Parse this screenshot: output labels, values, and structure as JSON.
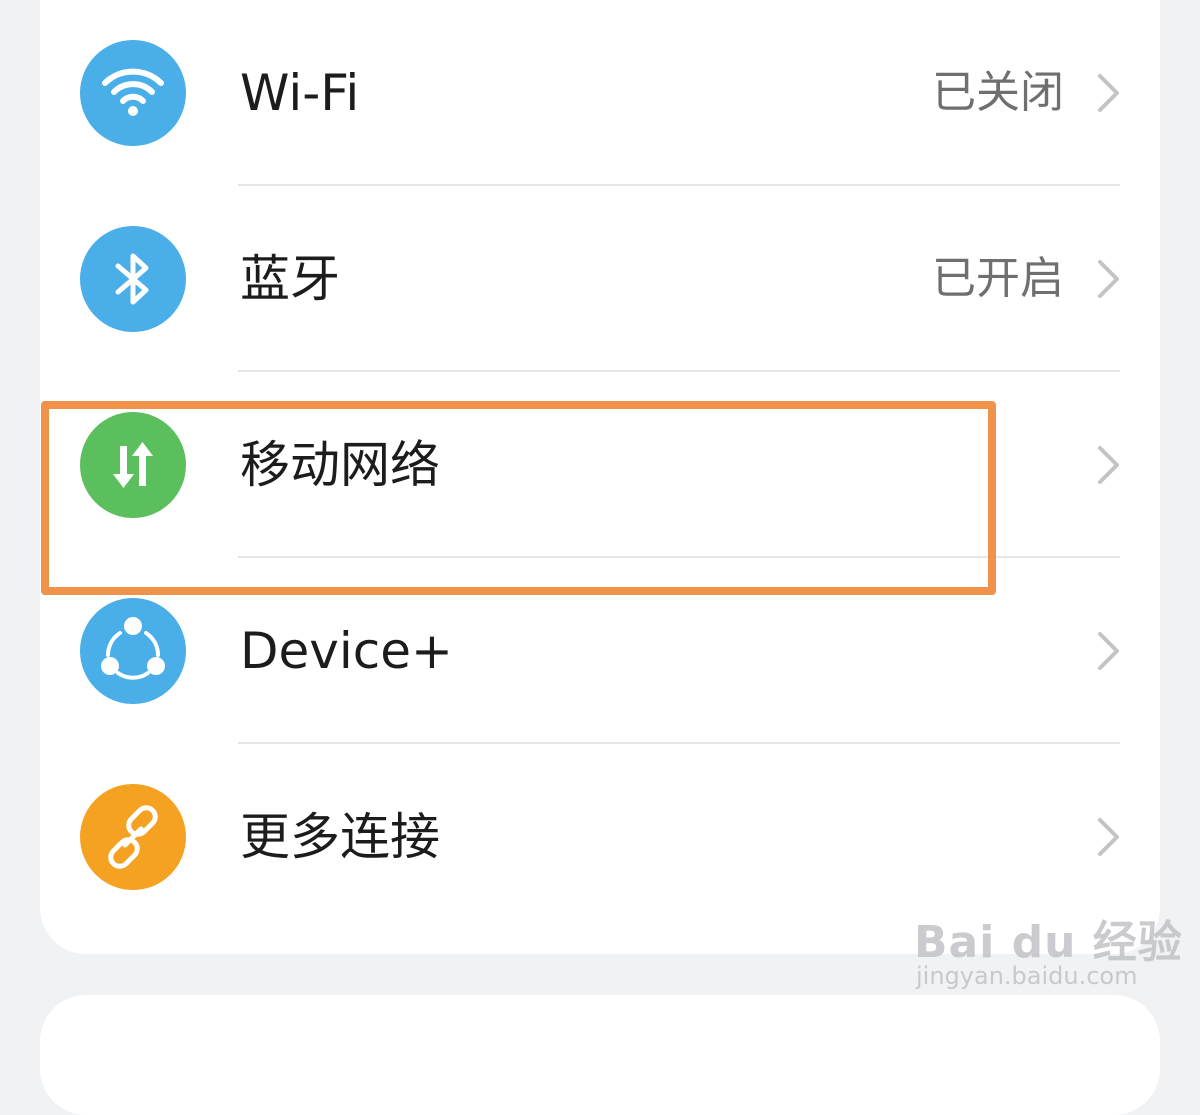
{
  "settings_list": [
    {
      "label": "Wi-Fi",
      "status": "已关闭",
      "icon": "wifi-icon",
      "icon_color": "#4aaee8"
    },
    {
      "label": "蓝牙",
      "status": "已开启",
      "icon": "bluetooth-icon",
      "icon_color": "#4aaee8"
    },
    {
      "label": "移动网络",
      "status": "",
      "icon": "mobile-data-icon",
      "icon_color": "#5cbf5e",
      "highlighted": true
    },
    {
      "label": "Device+",
      "status": "",
      "icon": "device-plus-icon",
      "icon_color": "#4aaee8"
    },
    {
      "label": "更多连接",
      "status": "",
      "icon": "link-icon",
      "icon_color": "#f5a223"
    }
  ],
  "highlight_color": "#f0924a",
  "watermark": {
    "logo": "Bai du 经验",
    "url": "jingyan.baidu.com"
  }
}
